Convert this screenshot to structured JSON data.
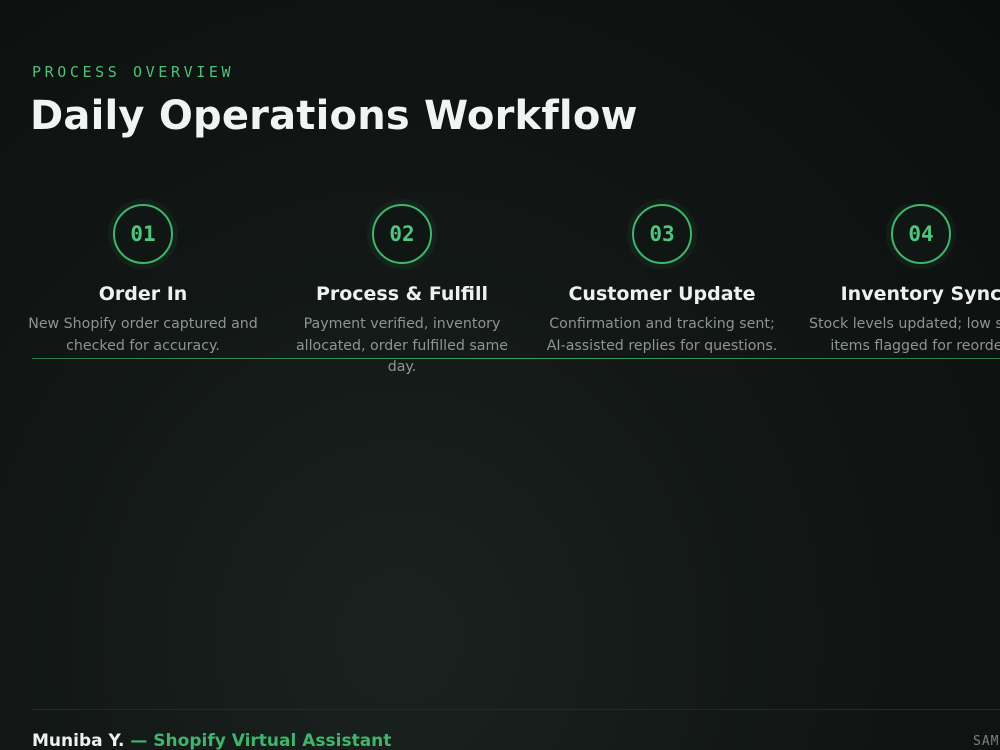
{
  "header": {
    "eyebrow": "PROCESS OVERVIEW",
    "title": "Daily Operations Workflow"
  },
  "steps": [
    {
      "number": "01",
      "title": "Order In",
      "description": "New Shopify order captured and checked for accuracy."
    },
    {
      "number": "02",
      "title": "Process & Fulfill",
      "description": "Payment verified, inventory allocated, order fulfilled same day."
    },
    {
      "number": "03",
      "title": "Customer Update",
      "description": "Confirmation and tracking sent; AI-assisted replies for questions."
    },
    {
      "number": "04",
      "title": "Inventory Sync",
      "description": "Stock levels updated; low stock items flagged for reorder."
    }
  ],
  "footer": {
    "name": "Muniba Y.",
    "role": " — Shopify Virtual Assistant",
    "tag": "SAM"
  },
  "colors": {
    "accent": "#3fb56c",
    "background": "#121715",
    "title_text": "#f2f4f3",
    "muted_text": "#8d9591"
  }
}
